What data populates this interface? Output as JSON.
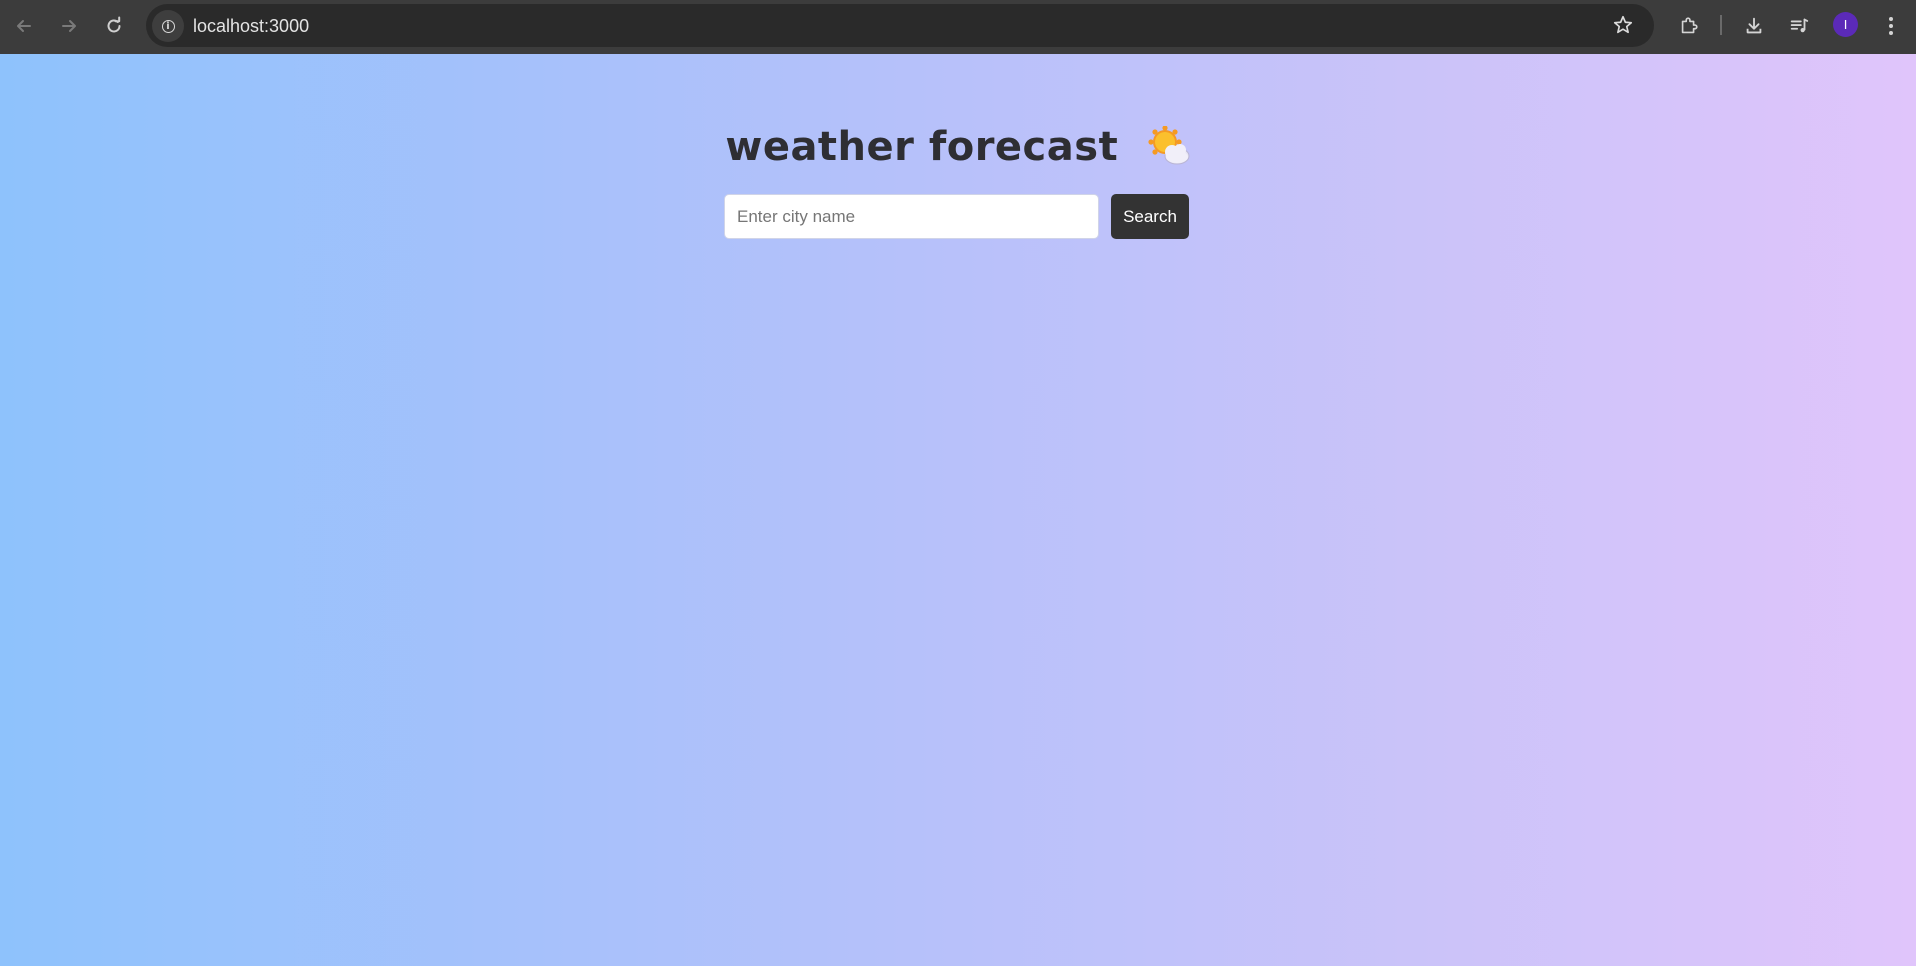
{
  "browser": {
    "url": "localhost:3000",
    "avatar_initial": "I",
    "icons": {
      "back": "arrow-left-icon",
      "forward": "arrow-right-icon",
      "reload": "reload-icon",
      "site_info": "info-icon",
      "bookmark": "star-icon",
      "extensions": "puzzle-icon",
      "downloads": "download-icon",
      "media": "media-queue-icon",
      "menu": "kebab-menu-icon"
    }
  },
  "page": {
    "title": "weather forecast",
    "title_emoji": "sun-behind-cloud-icon",
    "search": {
      "placeholder": "Enter city name",
      "value": "",
      "button_label": "Search"
    }
  },
  "colors": {
    "gradient_start": "#8ec2fc",
    "gradient_end": "#e0c5fb",
    "button_bg": "#333333",
    "title_color": "#2e2e33"
  }
}
